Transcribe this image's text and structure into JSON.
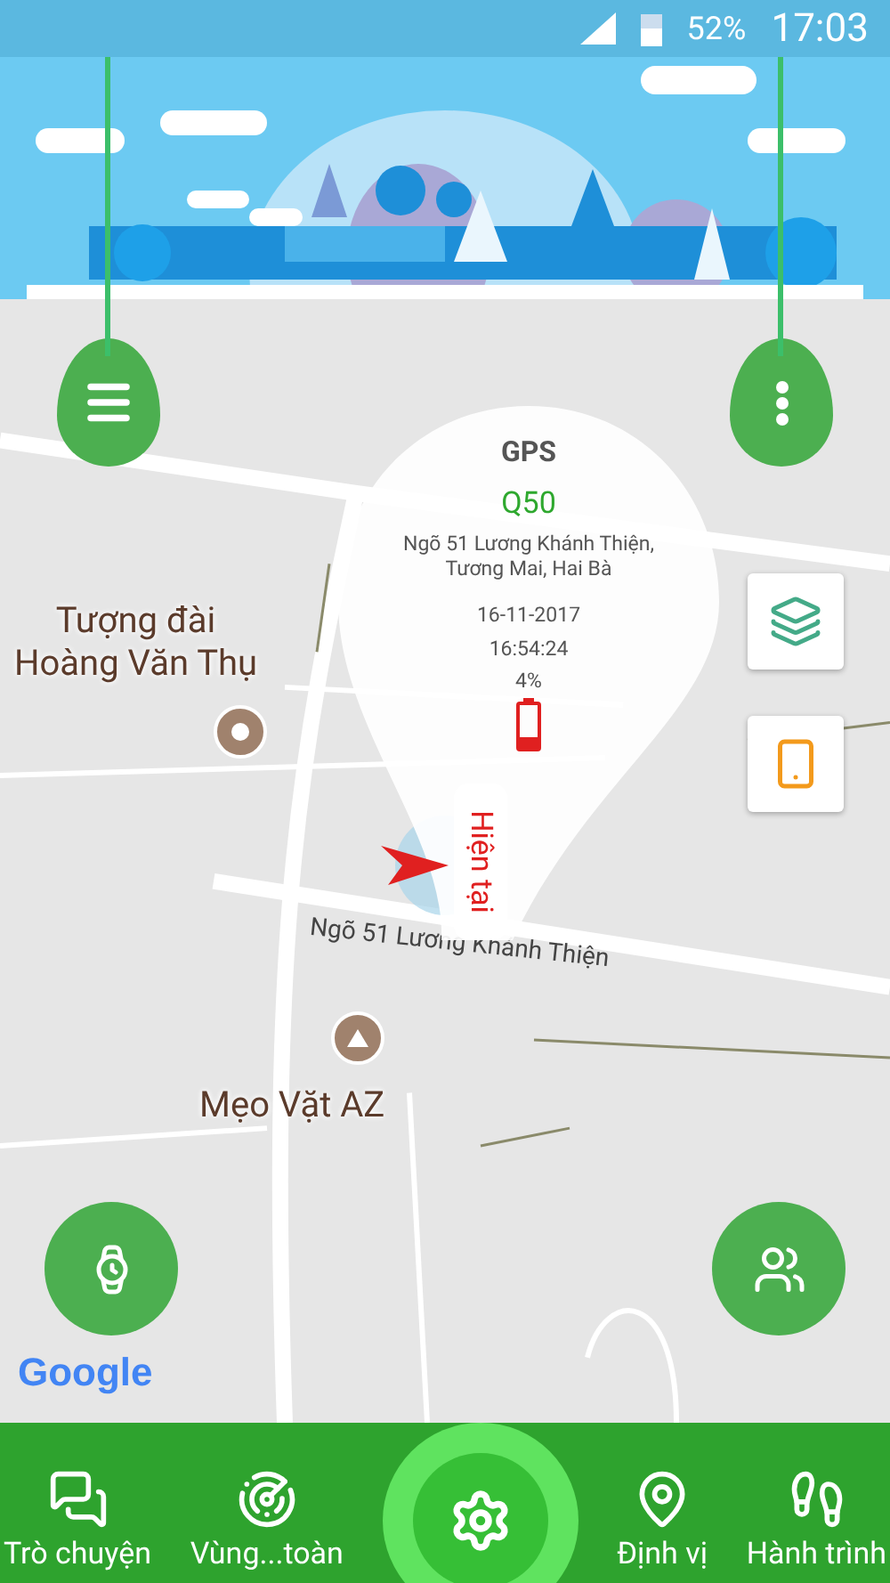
{
  "status_bar": {
    "battery": "52%",
    "time": "17:03"
  },
  "map": {
    "places": [
      {
        "kind": "monument",
        "label": "Tượng đài\nHoàng Văn Thụ"
      },
      {
        "kind": "shop",
        "label": "Mẹo Vặt AZ"
      }
    ],
    "street": "Ngõ 51 Lương Khánh Thiện",
    "attribution": "Google"
  },
  "popup": {
    "title": "GPS",
    "device": "Q50",
    "address": "Ngõ 51 Lương Khánh Thiện, Tương Mai, Hai Bà",
    "date": "16-11-2017",
    "time": "16:54:24",
    "battery": "4%"
  },
  "marker": {
    "label": "Hiện tại"
  },
  "nav": [
    {
      "kind": "chat",
      "label": "Trò chuyện"
    },
    {
      "kind": "radar",
      "label": "Vùng...toàn"
    },
    {
      "kind": "settings"
    },
    {
      "kind": "pin",
      "label": "Định vị"
    },
    {
      "kind": "steps",
      "label": "Hành trình"
    }
  ]
}
